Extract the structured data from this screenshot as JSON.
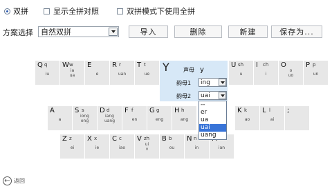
{
  "options": {
    "shuangpin": "双拼",
    "show_quanpin": "显示全拼对照",
    "use_quanpin_in_shuangpin": "双拼模式下使用全拼"
  },
  "scheme": {
    "label": "方案选择",
    "value": "自然双拼",
    "buttons": {
      "import": "导入",
      "delete": "删除",
      "new": "新建",
      "save_as": "保存为..."
    }
  },
  "keyboard": {
    "row1": [
      {
        "key": "Q",
        "sub": "q",
        "finals": [
          "iu"
        ]
      },
      {
        "key": "W",
        "sub": "w",
        "finals": [
          "ia",
          "ua"
        ]
      },
      {
        "key": "E",
        "sub": "",
        "finals": [
          "e"
        ]
      },
      {
        "key": "R",
        "sub": "r",
        "finals": [
          "uan"
        ]
      },
      {
        "key": "T",
        "sub": "t",
        "finals": [
          "ue"
        ]
      },
      {
        "key": "U",
        "sub": "sh",
        "finals": [
          "u"
        ]
      },
      {
        "key": "I",
        "sub": "ch",
        "finals": [
          "i"
        ]
      },
      {
        "key": "O",
        "sub": "",
        "finals": [
          "o",
          "uo"
        ]
      },
      {
        "key": "P",
        "sub": "p",
        "finals": [
          "un"
        ]
      }
    ],
    "row2": [
      {
        "key": "A",
        "sub": "",
        "finals": [
          "a"
        ]
      },
      {
        "key": "S",
        "sub": "s",
        "finals": [
          "iong",
          "ong"
        ]
      },
      {
        "key": "D",
        "sub": "d",
        "finals": [
          "iang",
          "uang"
        ]
      },
      {
        "key": "F",
        "sub": "f",
        "finals": [
          "en"
        ]
      },
      {
        "key": "G",
        "sub": "g",
        "finals": [
          "eng"
        ]
      },
      {
        "key": "H",
        "sub": "h",
        "finals": [
          "ang"
        ]
      },
      {
        "key": "K",
        "sub": "k",
        "finals": [
          "ao"
        ]
      },
      {
        "key": "L",
        "sub": "l",
        "finals": [
          "ai"
        ]
      },
      {
        "key": ";",
        "sub": "",
        "finals": []
      }
    ],
    "row3": [
      {
        "key": "Z",
        "sub": "z",
        "finals": [
          "ei"
        ]
      },
      {
        "key": "X",
        "sub": "x",
        "finals": [
          "ie"
        ]
      },
      {
        "key": "C",
        "sub": "c",
        "finals": [
          "iao"
        ]
      },
      {
        "key": "V",
        "sub": "zh",
        "finals": [
          "ui",
          "v"
        ]
      },
      {
        "key": "B",
        "sub": "b",
        "finals": [
          "ou"
        ]
      },
      {
        "key": "N",
        "sub": "n",
        "finals": [
          "in"
        ]
      },
      {
        "key": "M",
        "sub": "m",
        "finals": [
          "ian"
        ]
      }
    ]
  },
  "editor": {
    "key": "Y",
    "initial_label": "声母",
    "initial_value": "y",
    "final1_label": "韵母1",
    "final1_value": "ing",
    "final2_label": "韵母2",
    "final2_value": "uai",
    "dropdown_options": [
      "--",
      "er",
      "ua",
      "uai",
      "uang"
    ],
    "dropdown_selected": "uai"
  },
  "back_label": "返回",
  "colors": {
    "key_bg": "#e7e7e7",
    "panel_bg": "#d7e8f7",
    "highlight": "#3874d8"
  }
}
